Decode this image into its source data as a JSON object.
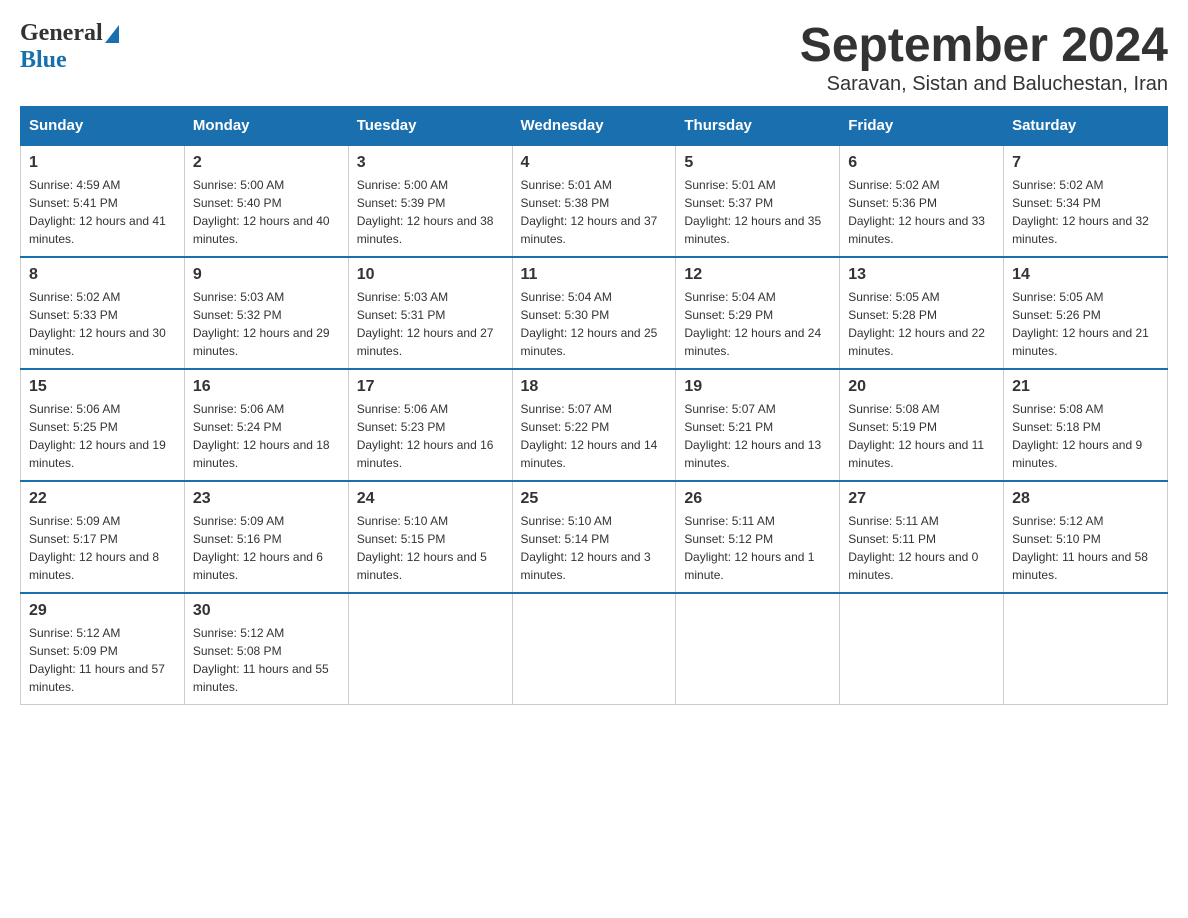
{
  "header": {
    "logo_general": "General",
    "logo_blue": "Blue",
    "title": "September 2024",
    "subtitle": "Saravan, Sistan and Baluchestan, Iran"
  },
  "weekdays": [
    "Sunday",
    "Monday",
    "Tuesday",
    "Wednesday",
    "Thursday",
    "Friday",
    "Saturday"
  ],
  "weeks": [
    [
      {
        "day": "1",
        "sunrise": "Sunrise: 4:59 AM",
        "sunset": "Sunset: 5:41 PM",
        "daylight": "Daylight: 12 hours and 41 minutes."
      },
      {
        "day": "2",
        "sunrise": "Sunrise: 5:00 AM",
        "sunset": "Sunset: 5:40 PM",
        "daylight": "Daylight: 12 hours and 40 minutes."
      },
      {
        "day": "3",
        "sunrise": "Sunrise: 5:00 AM",
        "sunset": "Sunset: 5:39 PM",
        "daylight": "Daylight: 12 hours and 38 minutes."
      },
      {
        "day": "4",
        "sunrise": "Sunrise: 5:01 AM",
        "sunset": "Sunset: 5:38 PM",
        "daylight": "Daylight: 12 hours and 37 minutes."
      },
      {
        "day": "5",
        "sunrise": "Sunrise: 5:01 AM",
        "sunset": "Sunset: 5:37 PM",
        "daylight": "Daylight: 12 hours and 35 minutes."
      },
      {
        "day": "6",
        "sunrise": "Sunrise: 5:02 AM",
        "sunset": "Sunset: 5:36 PM",
        "daylight": "Daylight: 12 hours and 33 minutes."
      },
      {
        "day": "7",
        "sunrise": "Sunrise: 5:02 AM",
        "sunset": "Sunset: 5:34 PM",
        "daylight": "Daylight: 12 hours and 32 minutes."
      }
    ],
    [
      {
        "day": "8",
        "sunrise": "Sunrise: 5:02 AM",
        "sunset": "Sunset: 5:33 PM",
        "daylight": "Daylight: 12 hours and 30 minutes."
      },
      {
        "day": "9",
        "sunrise": "Sunrise: 5:03 AM",
        "sunset": "Sunset: 5:32 PM",
        "daylight": "Daylight: 12 hours and 29 minutes."
      },
      {
        "day": "10",
        "sunrise": "Sunrise: 5:03 AM",
        "sunset": "Sunset: 5:31 PM",
        "daylight": "Daylight: 12 hours and 27 minutes."
      },
      {
        "day": "11",
        "sunrise": "Sunrise: 5:04 AM",
        "sunset": "Sunset: 5:30 PM",
        "daylight": "Daylight: 12 hours and 25 minutes."
      },
      {
        "day": "12",
        "sunrise": "Sunrise: 5:04 AM",
        "sunset": "Sunset: 5:29 PM",
        "daylight": "Daylight: 12 hours and 24 minutes."
      },
      {
        "day": "13",
        "sunrise": "Sunrise: 5:05 AM",
        "sunset": "Sunset: 5:28 PM",
        "daylight": "Daylight: 12 hours and 22 minutes."
      },
      {
        "day": "14",
        "sunrise": "Sunrise: 5:05 AM",
        "sunset": "Sunset: 5:26 PM",
        "daylight": "Daylight: 12 hours and 21 minutes."
      }
    ],
    [
      {
        "day": "15",
        "sunrise": "Sunrise: 5:06 AM",
        "sunset": "Sunset: 5:25 PM",
        "daylight": "Daylight: 12 hours and 19 minutes."
      },
      {
        "day": "16",
        "sunrise": "Sunrise: 5:06 AM",
        "sunset": "Sunset: 5:24 PM",
        "daylight": "Daylight: 12 hours and 18 minutes."
      },
      {
        "day": "17",
        "sunrise": "Sunrise: 5:06 AM",
        "sunset": "Sunset: 5:23 PM",
        "daylight": "Daylight: 12 hours and 16 minutes."
      },
      {
        "day": "18",
        "sunrise": "Sunrise: 5:07 AM",
        "sunset": "Sunset: 5:22 PM",
        "daylight": "Daylight: 12 hours and 14 minutes."
      },
      {
        "day": "19",
        "sunrise": "Sunrise: 5:07 AM",
        "sunset": "Sunset: 5:21 PM",
        "daylight": "Daylight: 12 hours and 13 minutes."
      },
      {
        "day": "20",
        "sunrise": "Sunrise: 5:08 AM",
        "sunset": "Sunset: 5:19 PM",
        "daylight": "Daylight: 12 hours and 11 minutes."
      },
      {
        "day": "21",
        "sunrise": "Sunrise: 5:08 AM",
        "sunset": "Sunset: 5:18 PM",
        "daylight": "Daylight: 12 hours and 9 minutes."
      }
    ],
    [
      {
        "day": "22",
        "sunrise": "Sunrise: 5:09 AM",
        "sunset": "Sunset: 5:17 PM",
        "daylight": "Daylight: 12 hours and 8 minutes."
      },
      {
        "day": "23",
        "sunrise": "Sunrise: 5:09 AM",
        "sunset": "Sunset: 5:16 PM",
        "daylight": "Daylight: 12 hours and 6 minutes."
      },
      {
        "day": "24",
        "sunrise": "Sunrise: 5:10 AM",
        "sunset": "Sunset: 5:15 PM",
        "daylight": "Daylight: 12 hours and 5 minutes."
      },
      {
        "day": "25",
        "sunrise": "Sunrise: 5:10 AM",
        "sunset": "Sunset: 5:14 PM",
        "daylight": "Daylight: 12 hours and 3 minutes."
      },
      {
        "day": "26",
        "sunrise": "Sunrise: 5:11 AM",
        "sunset": "Sunset: 5:12 PM",
        "daylight": "Daylight: 12 hours and 1 minute."
      },
      {
        "day": "27",
        "sunrise": "Sunrise: 5:11 AM",
        "sunset": "Sunset: 5:11 PM",
        "daylight": "Daylight: 12 hours and 0 minutes."
      },
      {
        "day": "28",
        "sunrise": "Sunrise: 5:12 AM",
        "sunset": "Sunset: 5:10 PM",
        "daylight": "Daylight: 11 hours and 58 minutes."
      }
    ],
    [
      {
        "day": "29",
        "sunrise": "Sunrise: 5:12 AM",
        "sunset": "Sunset: 5:09 PM",
        "daylight": "Daylight: 11 hours and 57 minutes."
      },
      {
        "day": "30",
        "sunrise": "Sunrise: 5:12 AM",
        "sunset": "Sunset: 5:08 PM",
        "daylight": "Daylight: 11 hours and 55 minutes."
      },
      null,
      null,
      null,
      null,
      null
    ]
  ]
}
